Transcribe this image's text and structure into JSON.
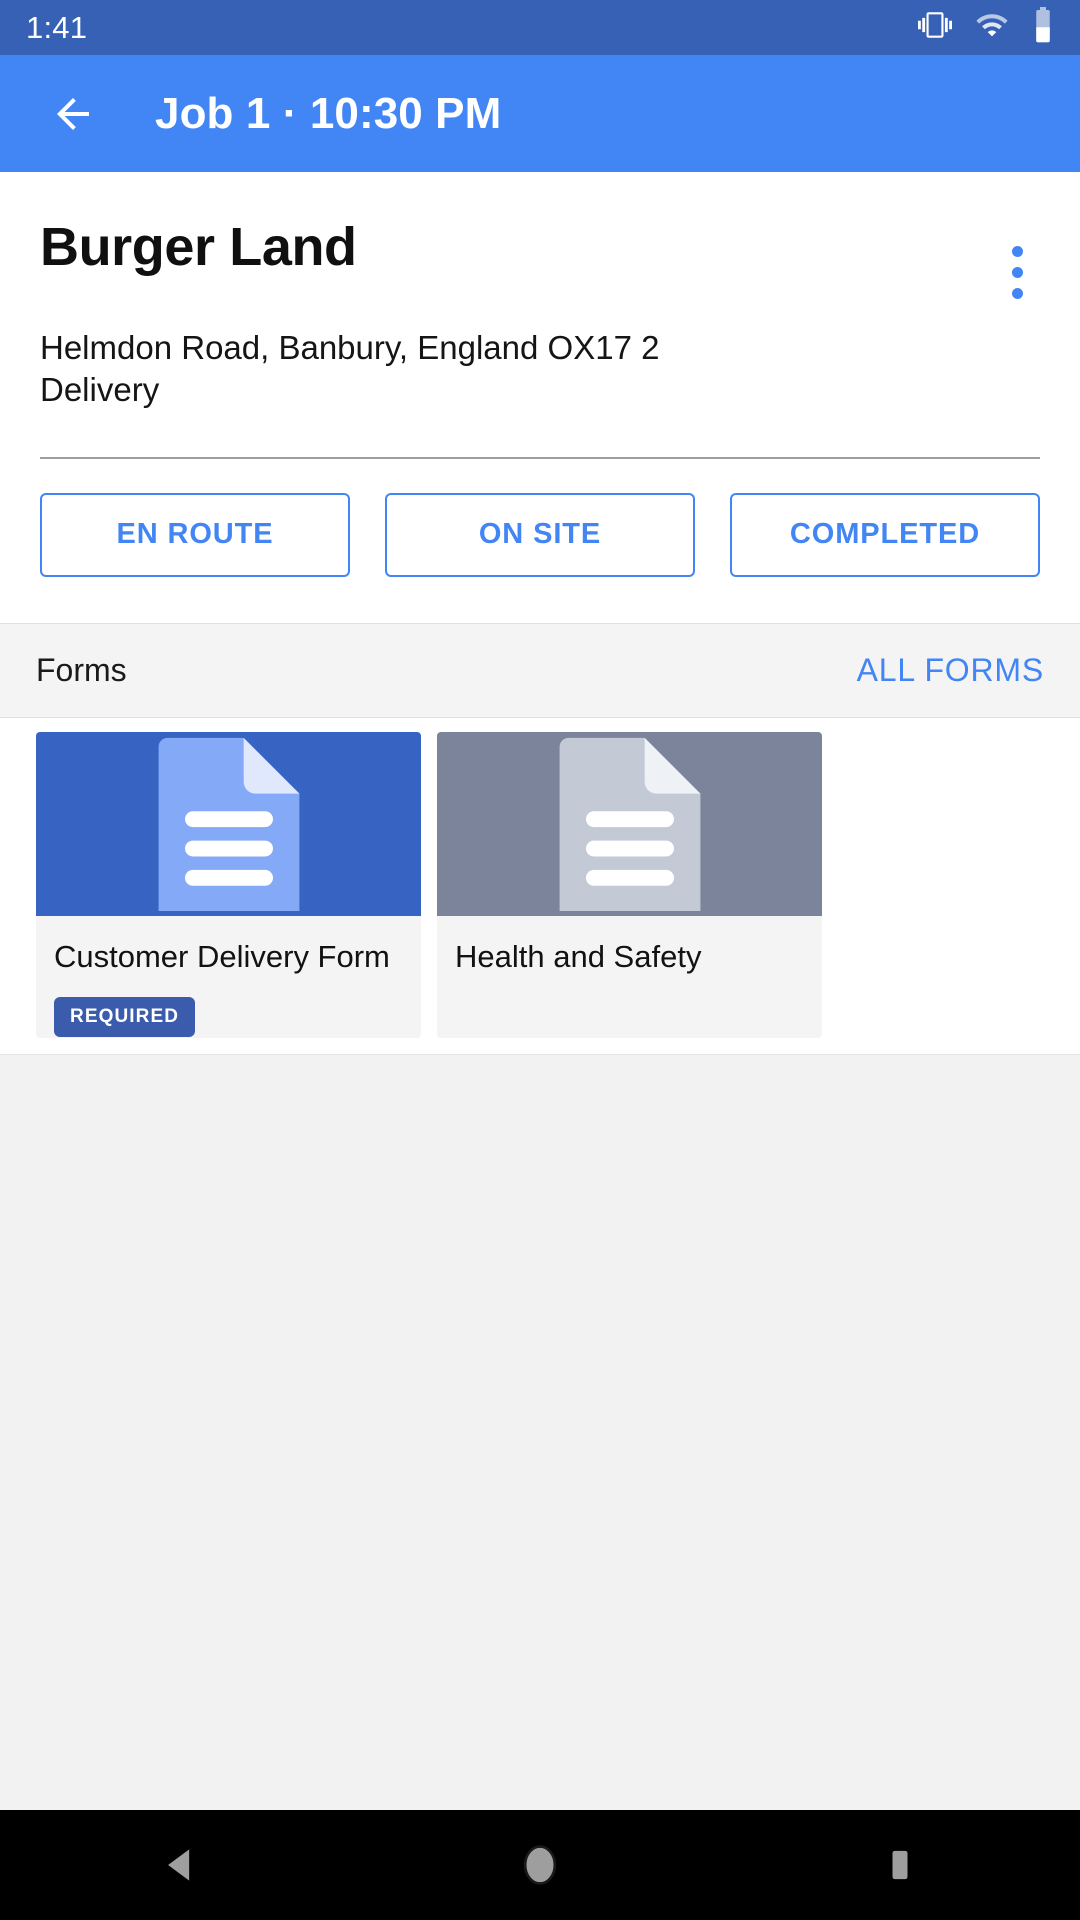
{
  "status_bar": {
    "time": "1:41",
    "icons": [
      "vibrate-icon",
      "wifi-icon",
      "battery-icon"
    ]
  },
  "app_bar": {
    "back_icon": "back-arrow-icon",
    "title": "Job 1 · 10:30 PM"
  },
  "job": {
    "title": "Burger Land",
    "address": "Helmdon Road, Banbury, England OX17 2",
    "type": "Delivery",
    "overflow_icon": "overflow-menu-icon",
    "status_buttons": [
      {
        "label": "EN ROUTE"
      },
      {
        "label": "ON SITE"
      },
      {
        "label": "COMPLETED"
      }
    ]
  },
  "forms_section": {
    "label": "Forms",
    "all_forms_link": "ALL FORMS",
    "cards": [
      {
        "name": "Customer Delivery Form",
        "badge": "REQUIRED",
        "thumb_icon": "document-icon",
        "thumb_style": "blue"
      },
      {
        "name": "Health and Safety",
        "badge": null,
        "thumb_icon": "document-icon",
        "thumb_style": "gray"
      }
    ]
  },
  "nav_bar": {
    "back": "nav-back-icon",
    "home": "nav-home-icon",
    "recents": "nav-recents-icon"
  },
  "colors": {
    "status_bar": "#3761b5",
    "app_bar": "#4285f4",
    "accent": "#4285f4",
    "badge": "#3b5cad",
    "card_blue": "#3764c3",
    "card_gray": "#7b849b",
    "page_bg": "#f2f2f2"
  }
}
